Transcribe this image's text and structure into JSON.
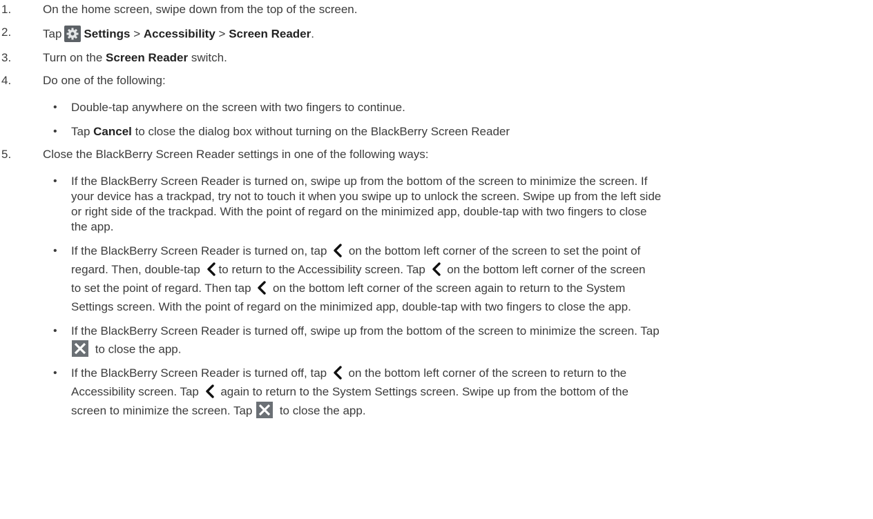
{
  "step1": {
    "num": "1.",
    "text": "On the home screen, swipe down from the top of the screen."
  },
  "step2": {
    "num": "2.",
    "tap": "Tap",
    "settings": "Settings",
    "sep1": " > ",
    "accessibility": "Accessibility",
    "sep2": " > ",
    "screen_reader": "Screen Reader",
    "end": "."
  },
  "step3": {
    "num": "3.",
    "pre": "Turn on the ",
    "bold": "Screen Reader",
    "post": " switch."
  },
  "step4": {
    "num": "4.",
    "text": "Do one of the following:",
    "b1": "Double-tap anywhere on the screen with two fingers to continue.",
    "b2_pre": "Tap ",
    "b2_bold": "Cancel",
    "b2_post": " to close the dialog box without turning on the BlackBerry Screen Reader"
  },
  "step5": {
    "num": "5.",
    "text": "Close the BlackBerry Screen Reader settings in one of the following ways:",
    "a1": "If the BlackBerry Screen Reader is turned on, swipe up from the bottom of the screen to minimize the screen. If",
    "a2": "your device has a trackpad, try not to touch it when you swipe up to unlock the screen. Swipe up from the left side",
    "a3": "or right side of the trackpad. With the point of regard on the minimized app, double-tap with two fingers to close",
    "a4": "the app.",
    "b1_pre": "If the BlackBerry Screen Reader is turned on, tap ",
    "b1_post": " on the bottom left corner of the screen to set the point of",
    "b2_pre": "regard. Then, double-tap ",
    "b2_mid": "to return to the Accessibility screen. Tap ",
    "b2_post": " on the bottom left corner of the screen",
    "b3_pre": "to set the point of regard. Then tap ",
    "b3_post": " on the bottom left corner of the screen again to return to the System",
    "b4": "Settings screen. With the point of regard on the minimized app, double-tap with two fingers to close the app.",
    "c1": "If the BlackBerry Screen Reader is turned off, swipe up from the bottom of the screen to minimize the screen. Tap",
    "c2": " to close the app.",
    "d1_pre": "If the BlackBerry Screen Reader is turned off, tap ",
    "d1_post": " on the bottom left corner of the screen to return to the",
    "d2_pre": "Accessibility screen. Tap ",
    "d2_post": " again to return to the System Settings screen. Swipe up from the bottom of the",
    "d3_pre": "screen to minimize the screen. Tap ",
    "d3_post": " to close the app."
  },
  "bullet": "•",
  "icons": {
    "settings": "gear-icon",
    "back": "chevron-left-icon",
    "close": "close-icon"
  }
}
